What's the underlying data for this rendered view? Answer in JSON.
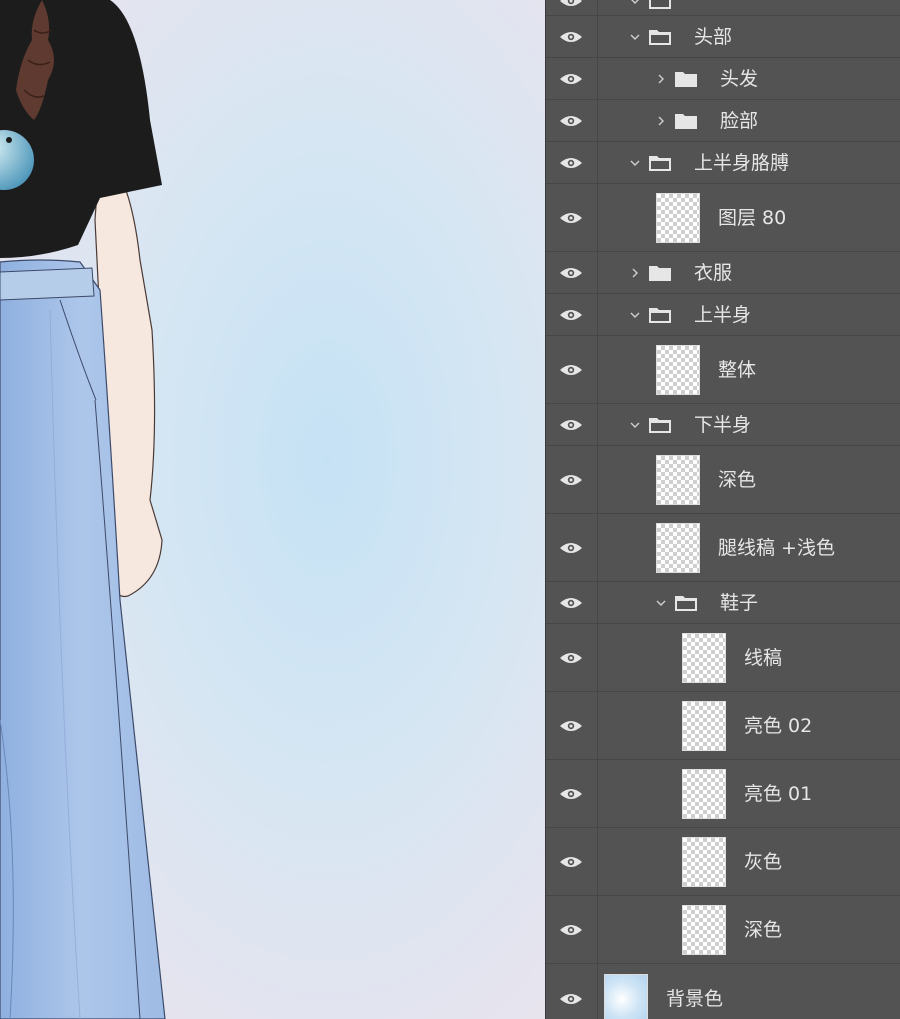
{
  "layers_panel": {
    "rows": [
      {
        "id": "top-group",
        "type": "group",
        "label": "",
        "expanded": true,
        "visible": true
      },
      {
        "id": "head",
        "type": "group",
        "label": "头部",
        "expanded": true,
        "visible": true
      },
      {
        "id": "hair",
        "type": "group",
        "label": "头发",
        "expanded": false,
        "visible": true
      },
      {
        "id": "face",
        "type": "group",
        "label": "脸部",
        "expanded": false,
        "visible": true
      },
      {
        "id": "upper-arm",
        "type": "group",
        "label": "上半身胳膊",
        "expanded": true,
        "visible": true
      },
      {
        "id": "layer80",
        "type": "layer",
        "label": "图层 80",
        "visible": true
      },
      {
        "id": "clothes",
        "type": "group",
        "label": "衣服",
        "expanded": false,
        "visible": true
      },
      {
        "id": "upper-body",
        "type": "group",
        "label": "上半身",
        "expanded": true,
        "visible": true
      },
      {
        "id": "whole",
        "type": "layer",
        "label": "整体",
        "visible": true
      },
      {
        "id": "lower-body",
        "type": "group",
        "label": "下半身",
        "expanded": true,
        "visible": true
      },
      {
        "id": "dark",
        "type": "layer",
        "label": "深色",
        "visible": true
      },
      {
        "id": "leg-line",
        "type": "layer",
        "label": "腿线稿 +浅色",
        "visible": true
      },
      {
        "id": "shoes",
        "type": "group",
        "label": "鞋子",
        "expanded": true,
        "visible": true
      },
      {
        "id": "line",
        "type": "layer",
        "label": "线稿",
        "visible": true
      },
      {
        "id": "light02",
        "type": "layer",
        "label": "亮色 02",
        "visible": true
      },
      {
        "id": "light01",
        "type": "layer",
        "label": "亮色 01",
        "visible": true
      },
      {
        "id": "gray",
        "type": "layer",
        "label": "灰色",
        "visible": true
      },
      {
        "id": "dark2",
        "type": "layer",
        "label": "深色",
        "visible": true
      },
      {
        "id": "bgcolor",
        "type": "layer",
        "label": "背景色",
        "visible": true
      }
    ]
  },
  "colors": {
    "panel_bg": "#535353",
    "text": "#e6e6e6",
    "canvas_bg": "#d2e4f2",
    "shirt": "#1c1c1c",
    "pants": "#a7c1e6"
  }
}
